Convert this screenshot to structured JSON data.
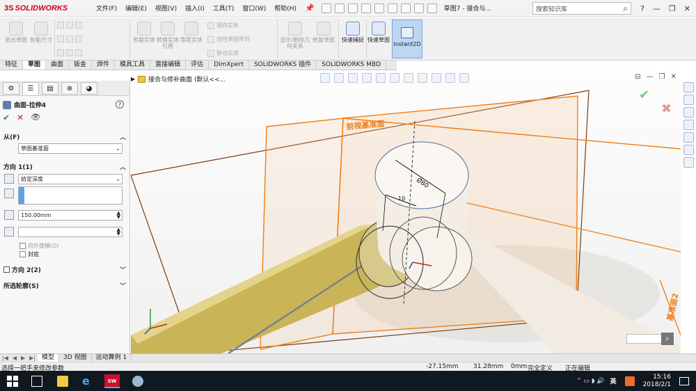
{
  "app": {
    "brand": "SOLIDWORKS",
    "brand_mark": "3S",
    "menus": [
      "文件(F)",
      "编辑(E)",
      "视图(V)",
      "插入(I)",
      "工具(T)",
      "窗口(W)",
      "帮助(H)"
    ],
    "doc_title": "草图7 - 接合与...",
    "search_placeholder": "搜索知识库",
    "window_controls": [
      "?",
      "—",
      "❐",
      "✕"
    ]
  },
  "ribbon": {
    "sketch_buttons": [
      "退出草图",
      "智能尺寸"
    ],
    "entity_buttons": [
      "剪裁实体",
      "转换实体引用",
      "等距实体"
    ],
    "small_items": [
      "镜向实体",
      "线性草图阵列",
      "移动实体"
    ],
    "relation_buttons": [
      "显示/删除几何关系",
      "修复草图"
    ],
    "snap_button": "快速捕捉",
    "quick_sketch": "快速草图",
    "instant2d": "Instant2D"
  },
  "command_tabs": [
    "特征",
    "草图",
    "曲面",
    "钣金",
    "焊件",
    "模具工具",
    "直接编辑",
    "评估",
    "DimXpert",
    "SOLIDWORKS 插件",
    "SOLIDWORKS MBD"
  ],
  "active_command_tab": 1,
  "property_manager": {
    "title": "曲面-拉伸4",
    "from_label": "从(F)",
    "from_value": "草图基准面",
    "direction1_label": "方向 1(1)",
    "end_condition": "给定深度",
    "depth": "150.00mm",
    "draft_outward": "向外拔模(O)",
    "cap_end": "封底",
    "direction2_label": "方向 2(2)",
    "contours_label": "所选轮廓(S)"
  },
  "viewport": {
    "breadcrumb": "接合与修补曲面 (默认<<...",
    "front_plane_label": "前视基准面",
    "plane2_label": "基准面2",
    "dim_diameter": "Ø80",
    "dim_length": "10"
  },
  "model_tabs": [
    "模型",
    "3D 视图",
    "运动算例 1"
  ],
  "active_model_tab": 0,
  "status": {
    "hint": "选择一把手来修改参数",
    "x": "-27.15mm",
    "y": "31.28mm",
    "z": "0mm",
    "state": "完全定义",
    "editing": "正在编辑"
  },
  "taskbar": {
    "sw_label": "SW 2016",
    "ime": "英",
    "time": "15:16",
    "date": "2018/2/1"
  },
  "colors": {
    "plane_orange": "#f07d12",
    "plane_brown": "#7a3b12",
    "extrude_yellow": "#c9b457",
    "cylinder_cream": "#f4ede4",
    "ok_green": "#1f9d2f",
    "cancel_red": "#d41f1f"
  }
}
